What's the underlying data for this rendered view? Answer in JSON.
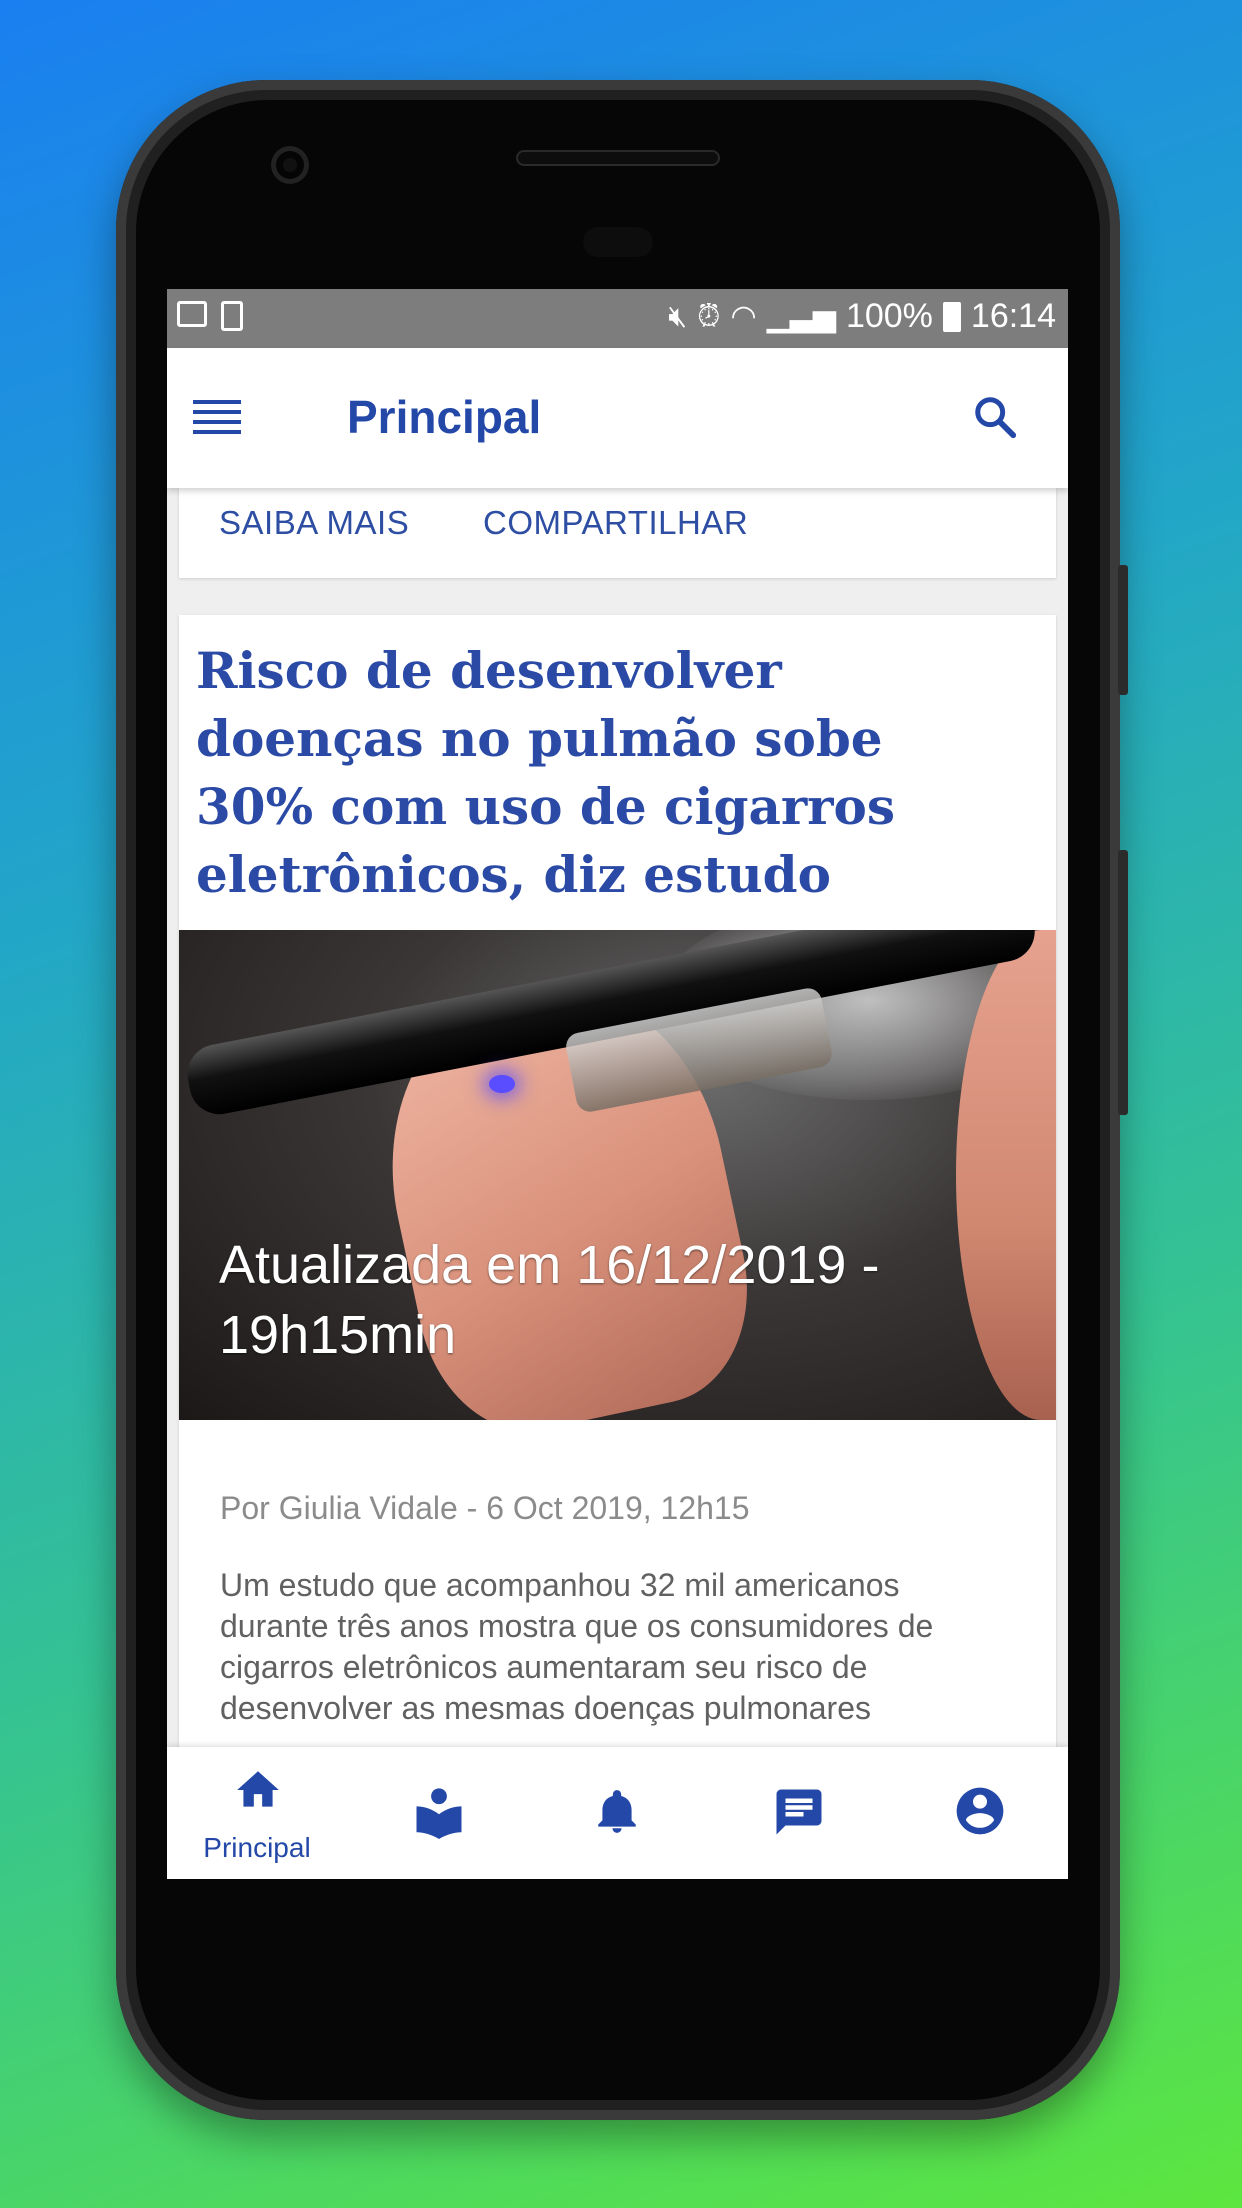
{
  "status_bar": {
    "battery_percent": "100%",
    "time": "16:14"
  },
  "app_bar": {
    "title": "Principal"
  },
  "previous_card": {
    "actions": [
      "SAIBA MAIS",
      "COMPARTILHAR"
    ]
  },
  "article": {
    "headline": "Risco de desenvolver doenças no pulmão sobe 30% com uso de cigarros eletrônicos, diz estudo",
    "image_caption": "Atualizada em 16/12/2019 - 19h15min",
    "byline": "Por Giulia Vidale - 6 Oct 2019, 12h15",
    "body": "Um estudo que acompanhou 32 mil americanos durante três anos mostra que os consumidores de cigarros eletrônicos aumentaram seu risco de desenvolver as mesmas doenças pulmonares"
  },
  "bottom_nav": {
    "items": [
      {
        "label": "Principal",
        "icon": "home-icon",
        "active": true
      },
      {
        "label": "",
        "icon": "reader-icon",
        "active": false
      },
      {
        "label": "",
        "icon": "bell-icon",
        "active": false
      },
      {
        "label": "",
        "icon": "chat-icon",
        "active": false
      },
      {
        "label": "",
        "icon": "account-icon",
        "active": false
      }
    ]
  },
  "colors": {
    "brand_blue": "#2448a8",
    "status_bar": "#7d7d7d",
    "background": "#efefef"
  }
}
